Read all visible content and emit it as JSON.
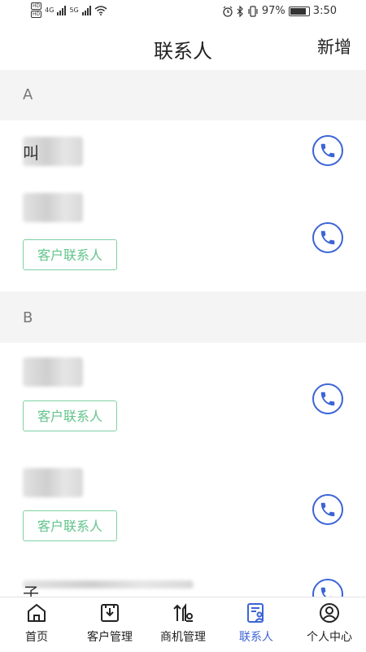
{
  "status_bar": {
    "sim1": "HD",
    "sim2": "HD",
    "net1": "4G",
    "net2": "5G",
    "battery": "97%",
    "battery_level": 0.97,
    "time": "3:50"
  },
  "header": {
    "title": "联系人",
    "add_label": "新增"
  },
  "sections": [
    {
      "letter": "A",
      "contacts": [
        {
          "name_visible": "叫",
          "tag": ""
        },
        {
          "name_visible": "",
          "tag": "客户联系人"
        }
      ]
    },
    {
      "letter": "B",
      "contacts": [
        {
          "name_visible": "",
          "tag": "客户联系人"
        },
        {
          "name_visible": "",
          "tag": "客户联系人"
        },
        {
          "name_visible": "子",
          "tag": ""
        }
      ]
    }
  ],
  "tabs": [
    {
      "label": "首页",
      "icon": "home-icon"
    },
    {
      "label": "客户管理",
      "icon": "customer-manage-icon"
    },
    {
      "label": "商机管理",
      "icon": "opportunity-icon"
    },
    {
      "label": "联系人",
      "icon": "contacts-icon",
      "active": true
    },
    {
      "label": "个人中心",
      "icon": "user-center-icon"
    }
  ],
  "colors": {
    "accent": "#3c64d6",
    "tag_green": "#62c48c",
    "section_bg": "#f4f4f4"
  }
}
